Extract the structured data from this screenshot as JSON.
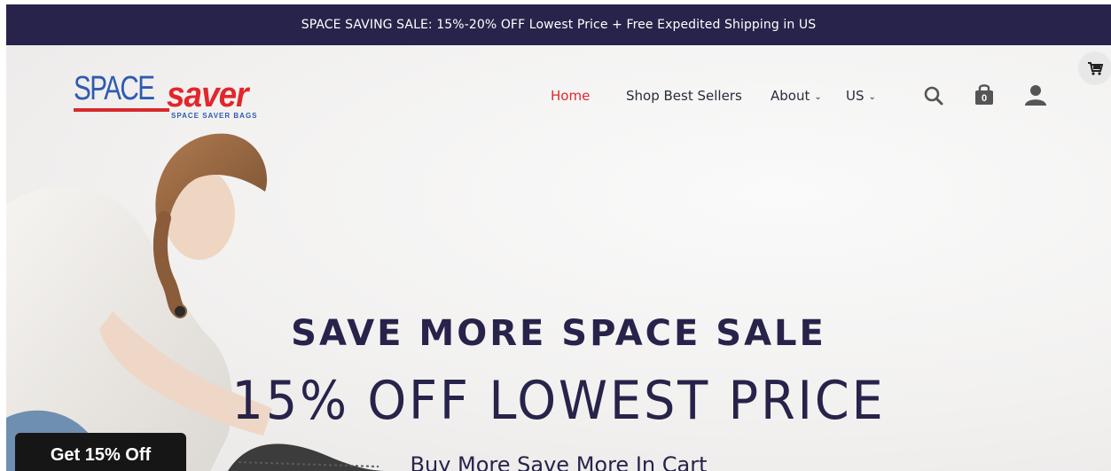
{
  "announcement": "SPACE SAVING SALE: 15%-20% OFF Lowest Price + Free Expedited Shipping in US",
  "logo": {
    "primary": "SPACE",
    "secondary": "saver",
    "tagline": "SPACE SAVER BAGS"
  },
  "nav": {
    "items": [
      {
        "label": "Home",
        "active": true
      },
      {
        "label": "Shop Best Sellers",
        "active": false
      },
      {
        "label": "About",
        "dropdown": true
      },
      {
        "label": "US",
        "dropdown": true
      }
    ],
    "cart_count": "0"
  },
  "icons": [
    "search-icon",
    "shopping-bag-icon",
    "user-icon",
    "cart-icon"
  ],
  "hero": {
    "headline": "SAVE MORE SPACE SALE",
    "subheadline": "15% OFF LOWEST PRICE",
    "tagline": "Buy More Save More In Cart"
  },
  "promo_button": "Get 15% Off",
  "colors": {
    "navy": "#27234a",
    "accent_red": "#e2262b",
    "logo_blue": "#2f5bb0"
  }
}
